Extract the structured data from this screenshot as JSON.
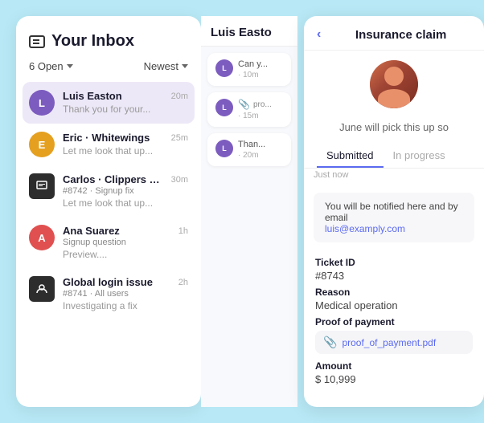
{
  "app": {
    "background_color": "#b8e8f5"
  },
  "inbox": {
    "icon_label": "inbox-box-icon",
    "title": "Your Inbox",
    "filter_open": "6 Open",
    "filter_newest": "Newest",
    "items": [
      {
        "id": "luis-easton",
        "avatar_letter": "L",
        "avatar_color": "avatar-L",
        "name": "Luis Easton",
        "preview": "Thank you for your...",
        "time": "20m",
        "active": true
      },
      {
        "id": "eric-whitewings",
        "avatar_letter": "E",
        "avatar_color": "avatar-E",
        "name": "Eric · Whitewings",
        "preview": "Let me look that up...",
        "time": "25m",
        "active": false
      },
      {
        "id": "carlos-clippers",
        "avatar_letter": "",
        "avatar_color": "avatar-C",
        "name": "Carlos · Clippers Co",
        "sub": "#8742 · Signup fix",
        "preview": "Let me look that up...",
        "time": "30m",
        "active": false,
        "has_icon": true
      },
      {
        "id": "ana-suarez",
        "avatar_letter": "A",
        "avatar_color": "avatar-A",
        "name": "Ana Suarez",
        "sub": "Signup question",
        "preview": "Preview....",
        "time": "1h",
        "active": false
      },
      {
        "id": "global-login",
        "avatar_letter": "",
        "avatar_color": "avatar-G",
        "name": "Global login issue",
        "sub": "#8741 · All users",
        "preview": "Investigating a fix",
        "time": "2h",
        "active": false,
        "has_icon": true
      }
    ]
  },
  "conversation": {
    "contact_name": "Luis Easto",
    "messages": [
      {
        "avatar_letter": "L",
        "text": "Can y...",
        "time": "10m",
        "has_attachment": false
      },
      {
        "avatar_letter": "L",
        "text": "pr...",
        "time": "15m",
        "has_attachment": true,
        "attachment_text": "pro..."
      },
      {
        "avatar_letter": "L",
        "text": "Than...",
        "time": "20m",
        "has_attachment": false
      }
    ]
  },
  "detail": {
    "back_label": "‹",
    "title": "Insurance claim",
    "avatar_alt": "User avatar",
    "pickup_notice": "June will pick this up so",
    "tabs": [
      {
        "label": "Submitted",
        "sub": "Just now",
        "active": true
      },
      {
        "label": "In progress",
        "sub": "",
        "active": false
      }
    ],
    "notification_text": "You will be notified here and by email",
    "notification_email": "luis@examply.com",
    "fields": [
      {
        "label": "Ticket ID",
        "value": "#8743"
      },
      {
        "label": "Reason",
        "value": "Medical operation"
      },
      {
        "label": "Proof of payment",
        "value": "",
        "is_file": true,
        "file_name": "proof_of_payment.pdf"
      },
      {
        "label": "Amount",
        "value": "$ 10,999"
      }
    ]
  }
}
